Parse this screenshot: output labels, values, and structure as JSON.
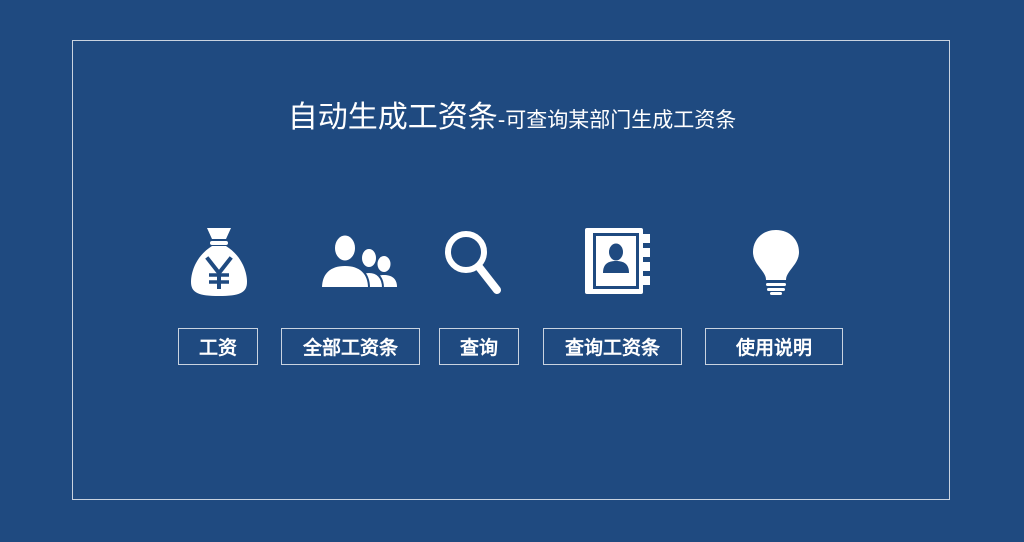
{
  "title": {
    "main": "自动生成工资条",
    "sub": "-可查询某部门生成工资条"
  },
  "colors": {
    "background": "#1f4a80",
    "foreground": "#ffffff",
    "border": "#c9d3e0"
  },
  "icons": {
    "money_bag": "money-bag-icon",
    "users_group": "users-group-icon",
    "search": "search-icon",
    "contact_book": "contact-book-icon",
    "light_bulb": "light-bulb-icon"
  },
  "buttons": {
    "salary": "工资",
    "all_payslips": "全部工资条",
    "query": "查询",
    "query_payslip": "查询工资条",
    "instructions": "使用说明"
  }
}
